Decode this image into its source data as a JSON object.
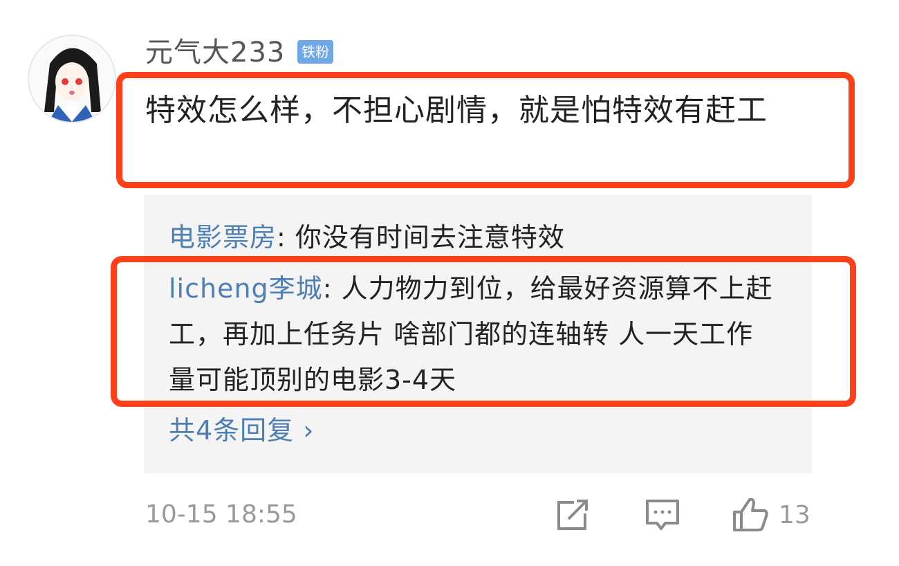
{
  "comment": {
    "username": "元气大233",
    "badge": "铁粉",
    "text": "特效怎么样，不担心剧情，就是怕特效有赶工",
    "timestamp": "10-15 18:55",
    "like_count": "13"
  },
  "replies": [
    {
      "author": "电影票房",
      "text": ": 你没有时间去注意特效"
    },
    {
      "author": "licheng李城",
      "text": ": 人力物力到位，给最好资源算不上赶工，再加上任务片 啥部门都的连轴转  人一天工作量可能顶别的电影3-4天"
    }
  ],
  "more_replies": "共4条回复 ›",
  "colors": {
    "highlight": "#ff4019",
    "link": "#4d7fb3",
    "badge": "#6ea8e8"
  },
  "icons": {
    "share": "share-icon",
    "reply": "comment-icon",
    "like": "thumbs-up-icon"
  }
}
